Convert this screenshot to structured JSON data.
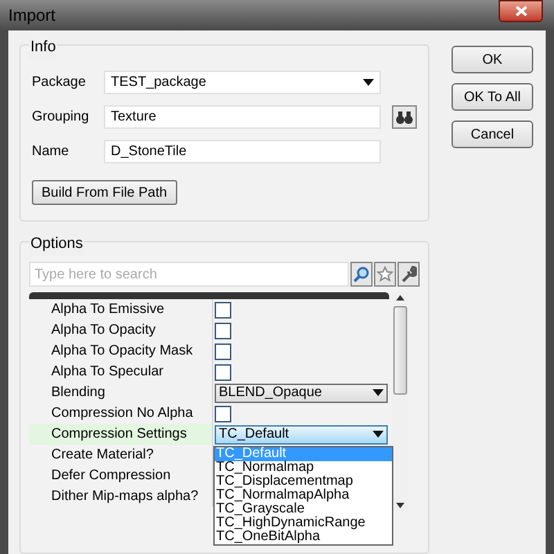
{
  "window": {
    "title": "Import"
  },
  "info": {
    "title": "Info",
    "fields": [
      {
        "label": "Package",
        "kind": "combo",
        "value": "TEST_package"
      },
      {
        "label": "Grouping",
        "kind": "browse",
        "value": "Texture"
      },
      {
        "label": "Name",
        "kind": "text",
        "value": "D_StoneTile"
      }
    ],
    "build_button": "Build From File Path"
  },
  "buttons": [
    "OK",
    "OK To All",
    "Cancel"
  ],
  "options": {
    "title": "Options",
    "search": {
      "placeholder": "Type here to search"
    },
    "rows": [
      {
        "name": "Alpha To Emissive",
        "kind": "checkbox",
        "checked": false,
        "selected": false
      },
      {
        "name": "Alpha To Opacity",
        "kind": "checkbox",
        "checked": false,
        "selected": false
      },
      {
        "name": "Alpha To Opacity Mask",
        "kind": "checkbox",
        "checked": false,
        "selected": false
      },
      {
        "name": "Alpha To Specular",
        "kind": "checkbox",
        "checked": false,
        "selected": false
      },
      {
        "name": "Blending",
        "kind": "combo",
        "value": "BLEND_Opaque",
        "selected": false
      },
      {
        "name": "Compression No Alpha",
        "kind": "checkbox",
        "checked": false,
        "selected": false
      },
      {
        "name": "Compression Settings",
        "kind": "combo",
        "value": "TC_Default",
        "selected": true,
        "open": true
      },
      {
        "name": "Create Material?",
        "kind": "hidden",
        "selected": false
      },
      {
        "name": "Defer Compression",
        "kind": "hidden",
        "selected": false
      },
      {
        "name": "Dither Mip-maps alpha?",
        "kind": "hidden",
        "selected": false
      }
    ],
    "dropdown": [
      {
        "label": "TC_Default",
        "selected": true
      },
      {
        "label": "TC_Normalmap",
        "selected": false
      },
      {
        "label": "TC_Displacementmap",
        "selected": false
      },
      {
        "label": "TC_NormalmapAlpha",
        "selected": false
      },
      {
        "label": "TC_Grayscale",
        "selected": false
      },
      {
        "label": "TC_HighDynamicRange",
        "selected": false
      },
      {
        "label": "TC_OneBitAlpha",
        "selected": false
      }
    ]
  }
}
